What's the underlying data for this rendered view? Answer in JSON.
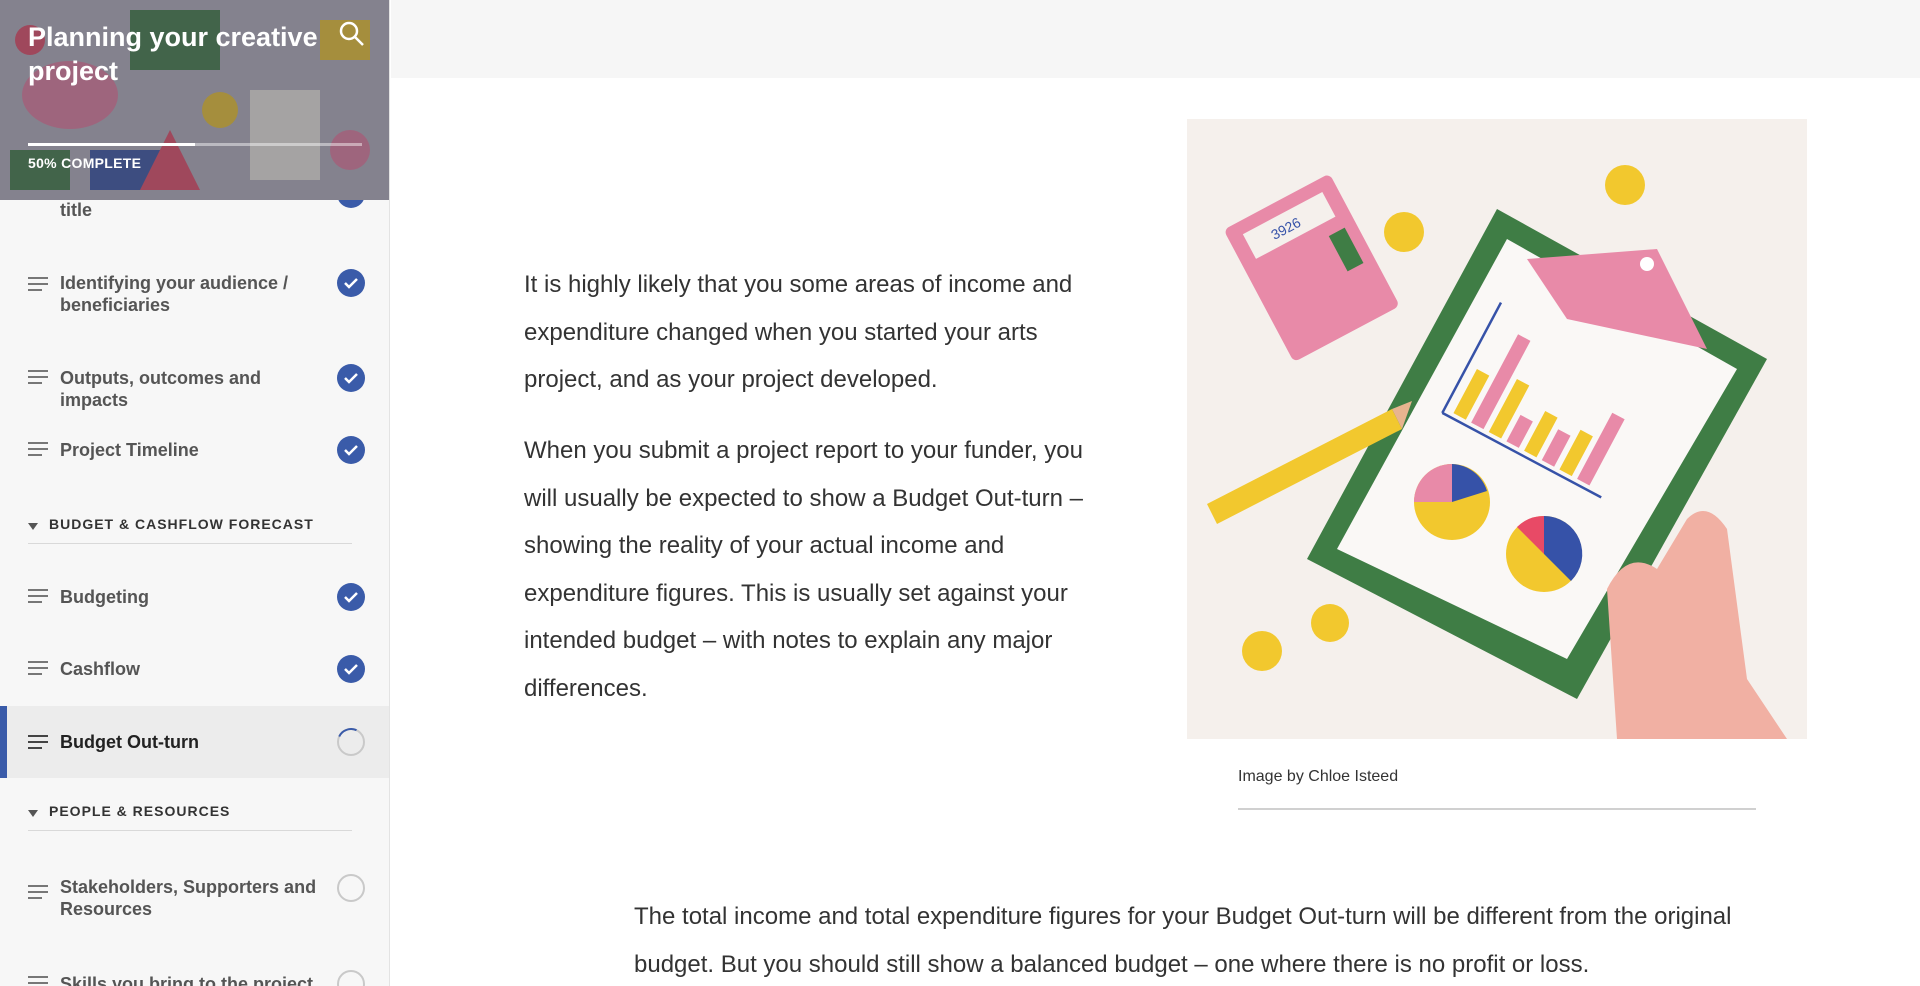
{
  "course": {
    "title": "Planning your creative project",
    "progress_percent": 50,
    "progress_label": "50% COMPLETE"
  },
  "sidebar": {
    "items": [
      {
        "label": "title",
        "status": "done"
      },
      {
        "label": "Identifying your audience / beneficiaries",
        "status": "done"
      },
      {
        "label": "Outputs, outcomes and impacts",
        "status": "done"
      },
      {
        "label": "Project Timeline",
        "status": "done"
      },
      {
        "label": "Budgeting",
        "status": "done"
      },
      {
        "label": "Cashflow",
        "status": "done"
      },
      {
        "label": "Budget Out-turn",
        "status": "in-progress"
      },
      {
        "label": "Stakeholders, Supporters and Resources",
        "status": "not-started"
      },
      {
        "label": "Skills you bring to the project",
        "status": "not-started"
      }
    ],
    "sections": [
      {
        "label": "BUDGET & CASHFLOW FORECAST"
      },
      {
        "label": "PEOPLE & RESOURCES"
      }
    ]
  },
  "main": {
    "para1": "It is highly likely that you some areas of income and expenditure changed when you started your arts project, and as your project developed.",
    "para2": "When you submit a project report to your funder, you will usually be expected to show a Budget Out-turn – showing the reality of your actual income and expenditure figures. This is usually set against your intended budget – with notes to explain any major differences.",
    "image_caption": "Image by Chloe Isteed",
    "para3": "The total income and total expenditure figures for your Budget Out-turn will be different from the original budget. But you should still show a balanced budget – one where there is no profit or loss.",
    "calculator_display": "3926"
  },
  "colors": {
    "accent": "#3a5ba9",
    "figure_green": "#3f7d45",
    "figure_pink": "#e88aa8",
    "figure_yellow": "#f2c82e"
  }
}
